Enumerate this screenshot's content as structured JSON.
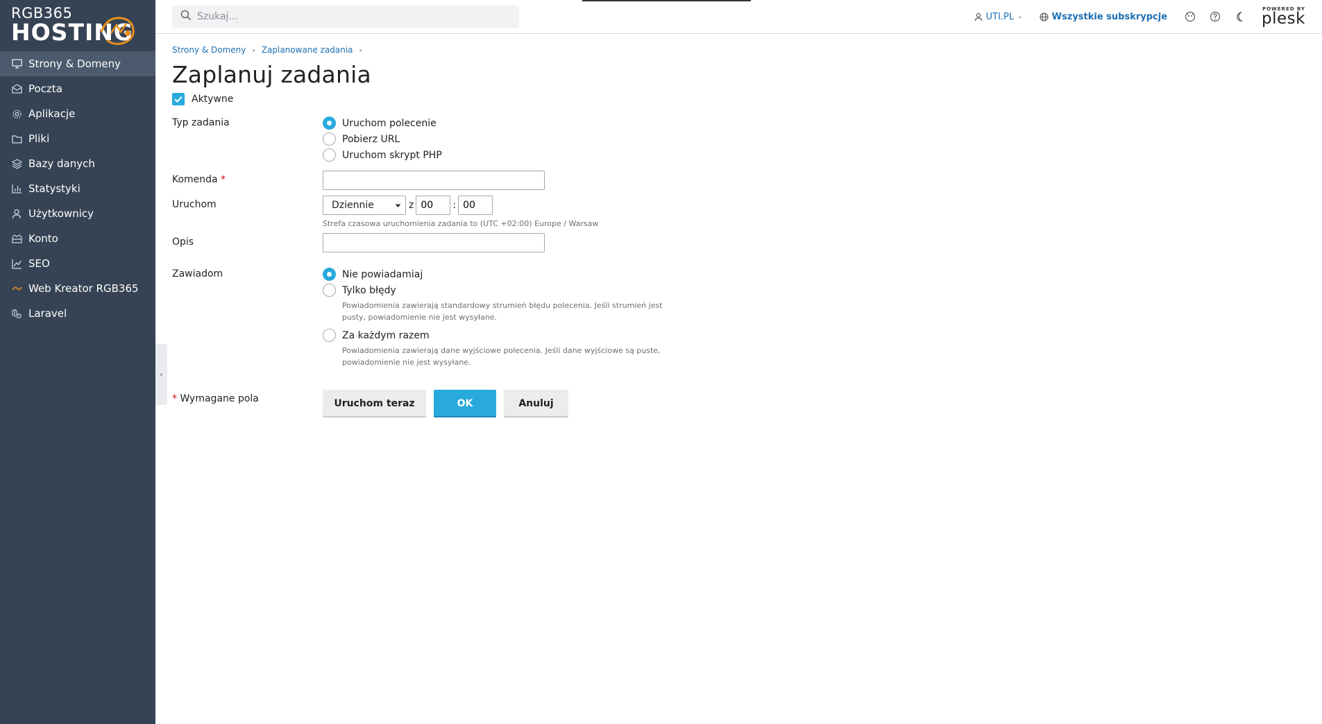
{
  "logo": {
    "line1": "RGB365",
    "line2": "HOSTING"
  },
  "sidebar": {
    "items": [
      {
        "label": "Strony & Domeny",
        "icon": "monitor-icon",
        "active": true
      },
      {
        "label": "Poczta",
        "icon": "envelope-icon"
      },
      {
        "label": "Aplikacje",
        "icon": "gear-icon"
      },
      {
        "label": "Pliki",
        "icon": "folder-icon"
      },
      {
        "label": "Bazy danych",
        "icon": "database-icon"
      },
      {
        "label": "Statystyki",
        "icon": "bar-chart-icon"
      },
      {
        "label": "Użytkownicy",
        "icon": "user-icon"
      },
      {
        "label": "Konto",
        "icon": "account-icon"
      },
      {
        "label": "SEO",
        "icon": "seo-icon"
      },
      {
        "label": "Web Kreator RGB365",
        "icon": "web-kreator-icon"
      },
      {
        "label": "Laravel",
        "icon": "laravel-icon"
      }
    ]
  },
  "header": {
    "search_placeholder": "Szukaj...",
    "user": "UTI.PL",
    "subscriptions": "Wszystkie subskrypcje",
    "powered_by": "POWERED BY",
    "brand": "plesk"
  },
  "breadcrumb": [
    "Strony & Domeny",
    "Zaplanowane zadania"
  ],
  "page_title": "Zaplanuj zadania",
  "form": {
    "active_label": "Aktywne",
    "active_checked": true,
    "task_type": {
      "label": "Typ zadania",
      "options": [
        "Uruchom polecenie",
        "Pobierz URL",
        "Uruchom skrypt PHP"
      ],
      "selected": "Uruchom polecenie"
    },
    "command": {
      "label": "Komenda",
      "required_mark": "*",
      "value": ""
    },
    "run": {
      "label": "Uruchom",
      "frequency": "Dziennie",
      "at_label": "z",
      "hour": "00",
      "time_sep": ":",
      "minute": "00",
      "timezone_hint": "Strefa czasowa uruchomienia zadania to (UTC +02:00) Europe / Warsaw"
    },
    "description": {
      "label": "Opis",
      "value": ""
    },
    "notify": {
      "label": "Zawiadom",
      "options": [
        {
          "label": "Nie powiadamiaj",
          "hint": ""
        },
        {
          "label": "Tylko błędy",
          "hint": "Powiadomienia zawierają standardowy strumień błędu polecenia. Jeśli strumień jest pusty, powiadomienie nie jest wysyłane."
        },
        {
          "label": "Za każdym razem",
          "hint": "Powiadomienia zawierają dane wyjściowe polecenia. Jeśli dane wyjściowe są puste, powiadomienie nie jest wysyłane."
        }
      ],
      "selected": "Nie powiadamiaj"
    },
    "required_mark": "*",
    "required_note": "Wymagane pola",
    "buttons": {
      "run_now": "Uruchom teraz",
      "ok": "OK",
      "cancel": "Anuluj"
    }
  },
  "colors": {
    "sidebar": "#364354",
    "sidebar_active": "#4b5a6d",
    "accent": "#28aade",
    "link": "#1e6fb3",
    "required": "#d0021b"
  }
}
